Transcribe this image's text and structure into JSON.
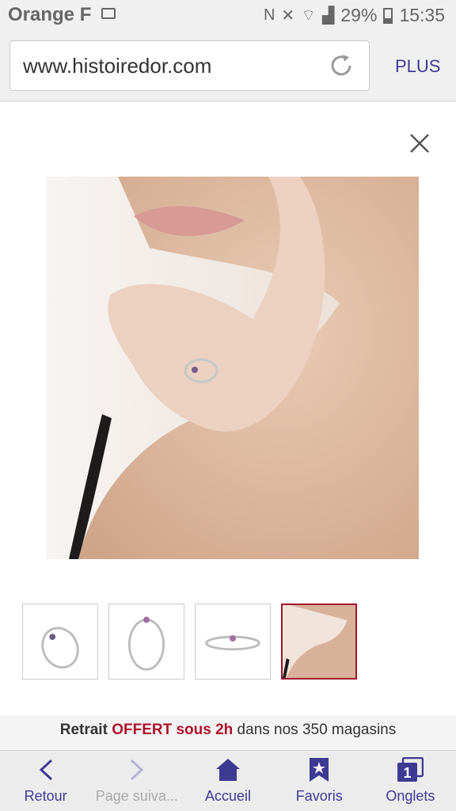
{
  "status_bar": {
    "carrier": "Orange F",
    "battery": "29%",
    "time": "15:35"
  },
  "browser": {
    "url": "www.histoiredor.com",
    "more_label": "PLUS"
  },
  "promo": {
    "part1": "Retrait ",
    "part2": "OFFERT sous 2h",
    "part3": " dans nos 350 magasins"
  },
  "bottom_nav": {
    "back": "Retour",
    "forward": "Page suiva...",
    "home": "Accueil",
    "favorites": "Favoris",
    "tabs": "Onglets",
    "tabs_count": "1"
  },
  "colors": {
    "accent": "#3e3a94",
    "promo_red": "#b0102b",
    "active_thumb_border": "#a3122e"
  }
}
